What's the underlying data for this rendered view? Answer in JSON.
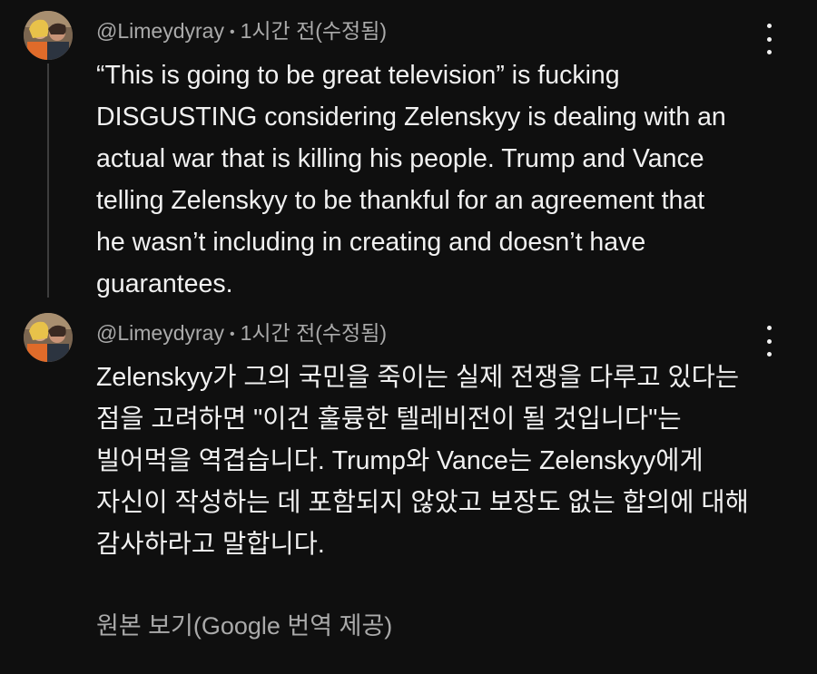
{
  "comments": [
    {
      "author": "@Limeydyray",
      "separator": "•",
      "time": "1시간 전(수정됨)",
      "lines": [
        "“This is going to be great television” is fucking",
        "DISGUSTING considering Zelenskyy is dealing with an",
        "actual war that is killing his people. Trump and Vance",
        "telling Zelenskyy to be thankful for an agreement that",
        "he wasn’t including in creating and doesn’t have",
        "guarantees."
      ]
    },
    {
      "author": "@Limeydyray",
      "separator": "•",
      "time": "1시간 전(수정됨)",
      "lines": [
        "Zelenskyy가 그의 국민을 죽이는 실제 전쟁을 다루고 있다는",
        "점을 고려하면 \"이건 훌륭한 텔레비전이 될 것입니다\"는",
        "빌어먹을 역겹습니다. Trump와 Vance는 Zelenskyy에게",
        "자신이 작성하는 데 포함되지 않았고 보장도 없는 합의에 대해",
        "감사하라고 말합니다."
      ]
    }
  ],
  "translate_link": "원본 보기(Google 번역 제공)",
  "icons": {
    "avatar": "avatar-photo",
    "menu": "more-vert-icon"
  },
  "colors": {
    "background": "#0f0f0f",
    "text_primary": "#f1f1f1",
    "text_secondary": "#aaaaaa",
    "thread_line": "#3d3d3d"
  }
}
